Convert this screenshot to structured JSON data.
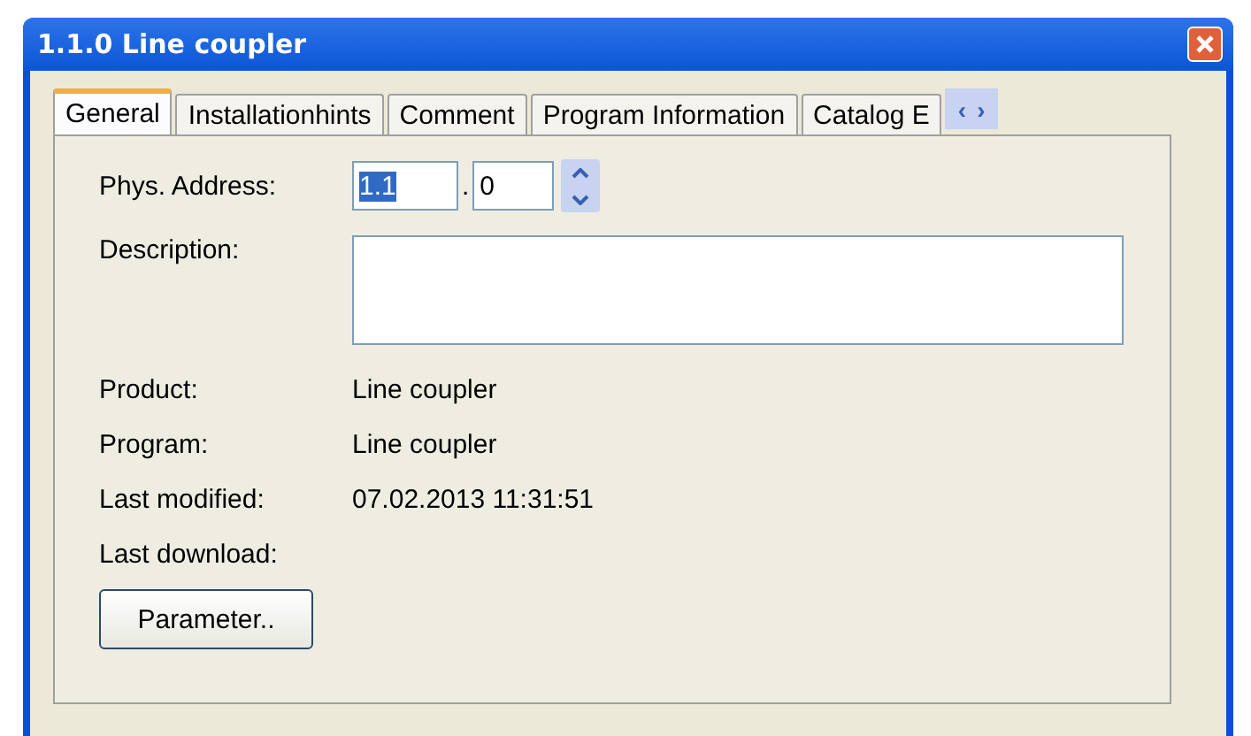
{
  "window": {
    "title": "1.1.0 Line coupler"
  },
  "tabs": [
    {
      "label": "General",
      "selected": true
    },
    {
      "label": "Installationhints",
      "selected": false
    },
    {
      "label": "Comment",
      "selected": false
    },
    {
      "label": "Program Information",
      "selected": false
    },
    {
      "label": "Catalog E",
      "selected": false
    }
  ],
  "tab_scroll": [
    "‹",
    "›"
  ],
  "address": {
    "label": "Phys. Address:",
    "parts": [
      {
        "value": "1.1",
        "highlighted": true
      },
      {
        "value": "0",
        "highlighted": false
      }
    ],
    "separator": "."
  },
  "description": {
    "label": "Description:"
  },
  "info": [
    {
      "label": "Product:",
      "value": "Line coupler"
    },
    {
      "label": "Program:",
      "value": "Line coupler"
    },
    {
      "label": "Last modified:",
      "value": "07.02.2013 11:31:51"
    },
    {
      "label": "Last download:"
    }
  ],
  "buttons": [
    "Parameter.."
  ]
}
